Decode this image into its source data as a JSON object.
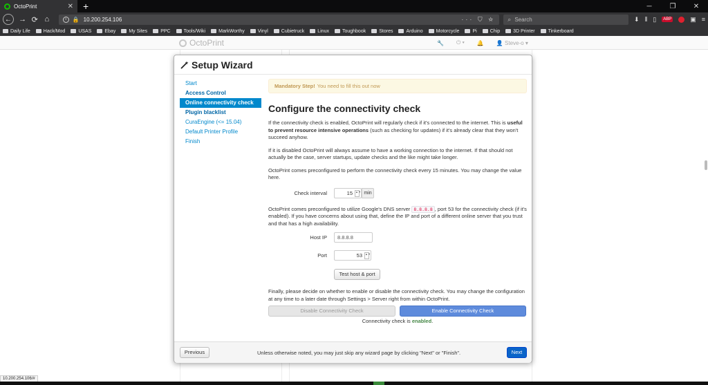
{
  "browser": {
    "tab_title": "OctoPrint",
    "tab_close": "✕",
    "new_tab": "+",
    "win_controls": [
      "─",
      "❐",
      "✕"
    ],
    "nav_back": "←",
    "nav_forward": "→",
    "nav_reload": "⟳",
    "nav_home": "⌂",
    "url": "10.200.254.106",
    "url_actions": "··· ⛉ ☆",
    "search_placeholder": "Search",
    "toolbar_abp": "ABP",
    "bookmarks": [
      "Daily Life",
      "Hack/Mod",
      "USAS",
      "Ebay",
      "My Sites",
      "PPC",
      "Tools/Wiki",
      "MarkWorthy",
      "Vinyl",
      "Cubietruck",
      "Linux",
      "Toughbook",
      "Stores",
      "Arduino",
      "Motorcycle",
      "Pi",
      "Chip",
      "3D Printer",
      "Tinkerboard"
    ],
    "status_url": "10.200.254.106/#"
  },
  "octonav": {
    "brand": "OctoPrint",
    "wrench": "🔧",
    "power": "⏻ ▾",
    "bell": "🔔",
    "user": "👤 Steve-o ▾"
  },
  "wizard": {
    "title": "Setup Wizard",
    "steps": [
      {
        "label": "Start"
      },
      {
        "label": "Access Control"
      },
      {
        "label": "Online connectivity check"
      },
      {
        "label": "Plugin blacklist"
      },
      {
        "label": "CuraEngine (<= 15.04)"
      },
      {
        "label": "Default Printer Profile"
      },
      {
        "label": "Finish"
      }
    ],
    "alert_strong": "Mandatory Step!",
    "alert_text": "You need to fill this out now",
    "heading": "Configure the connectivity check",
    "p1_a": "If the connectivity check is enabled, OctoPrint will regularly check if it's connected to the internet. This is ",
    "p1_b": "useful to prevent resource intensive operations",
    "p1_c": " (such as checking for updates) if it's already clear that they won't succeed anyhow.",
    "p2": "If it is disabled OctoPrint will always assume to have a working connection to the internet. If that should not actually be the case, server startups, update checks and the like might take longer.",
    "p3": "OctoPrint comes preconfigured to perform the connectivity check every 15 minutes. You may change the value here.",
    "interval_label": "Check interval",
    "interval_value": "15",
    "interval_unit": "min",
    "p4_a": "OctoPrint comes preconfigured to utilize Google's DNS server ",
    "p4_code": "8.8.8.8",
    "p4_b": ", port 53 for the connectivity check (if it's enabled). If you have concerns about using that, define the IP and port of a different online server that you trust and that has a high availability.",
    "host_label": "Host IP",
    "host_value": "8.8.8.8",
    "port_label": "Port",
    "port_value": "53",
    "spin_arrows": "▲▼",
    "test_button": "Test host & port",
    "p5": "Finally, please decide on whether to enable or disable the connectivity check. You may change the configuration at any time to a later date through Settings > Server right from within OctoPrint.",
    "disable_button": "Disable Connectivity Check",
    "enable_button": "Enable Connectivity Check",
    "status_prefix": "Connectivity check is ",
    "status_value": "enabled",
    "status_suffix": ".",
    "footer_note": "Unless otherwise noted, you may just skip any wizard page by clicking \"Next\" or \"Finish\".",
    "prev_button": "Previous",
    "next_button": "Next"
  }
}
